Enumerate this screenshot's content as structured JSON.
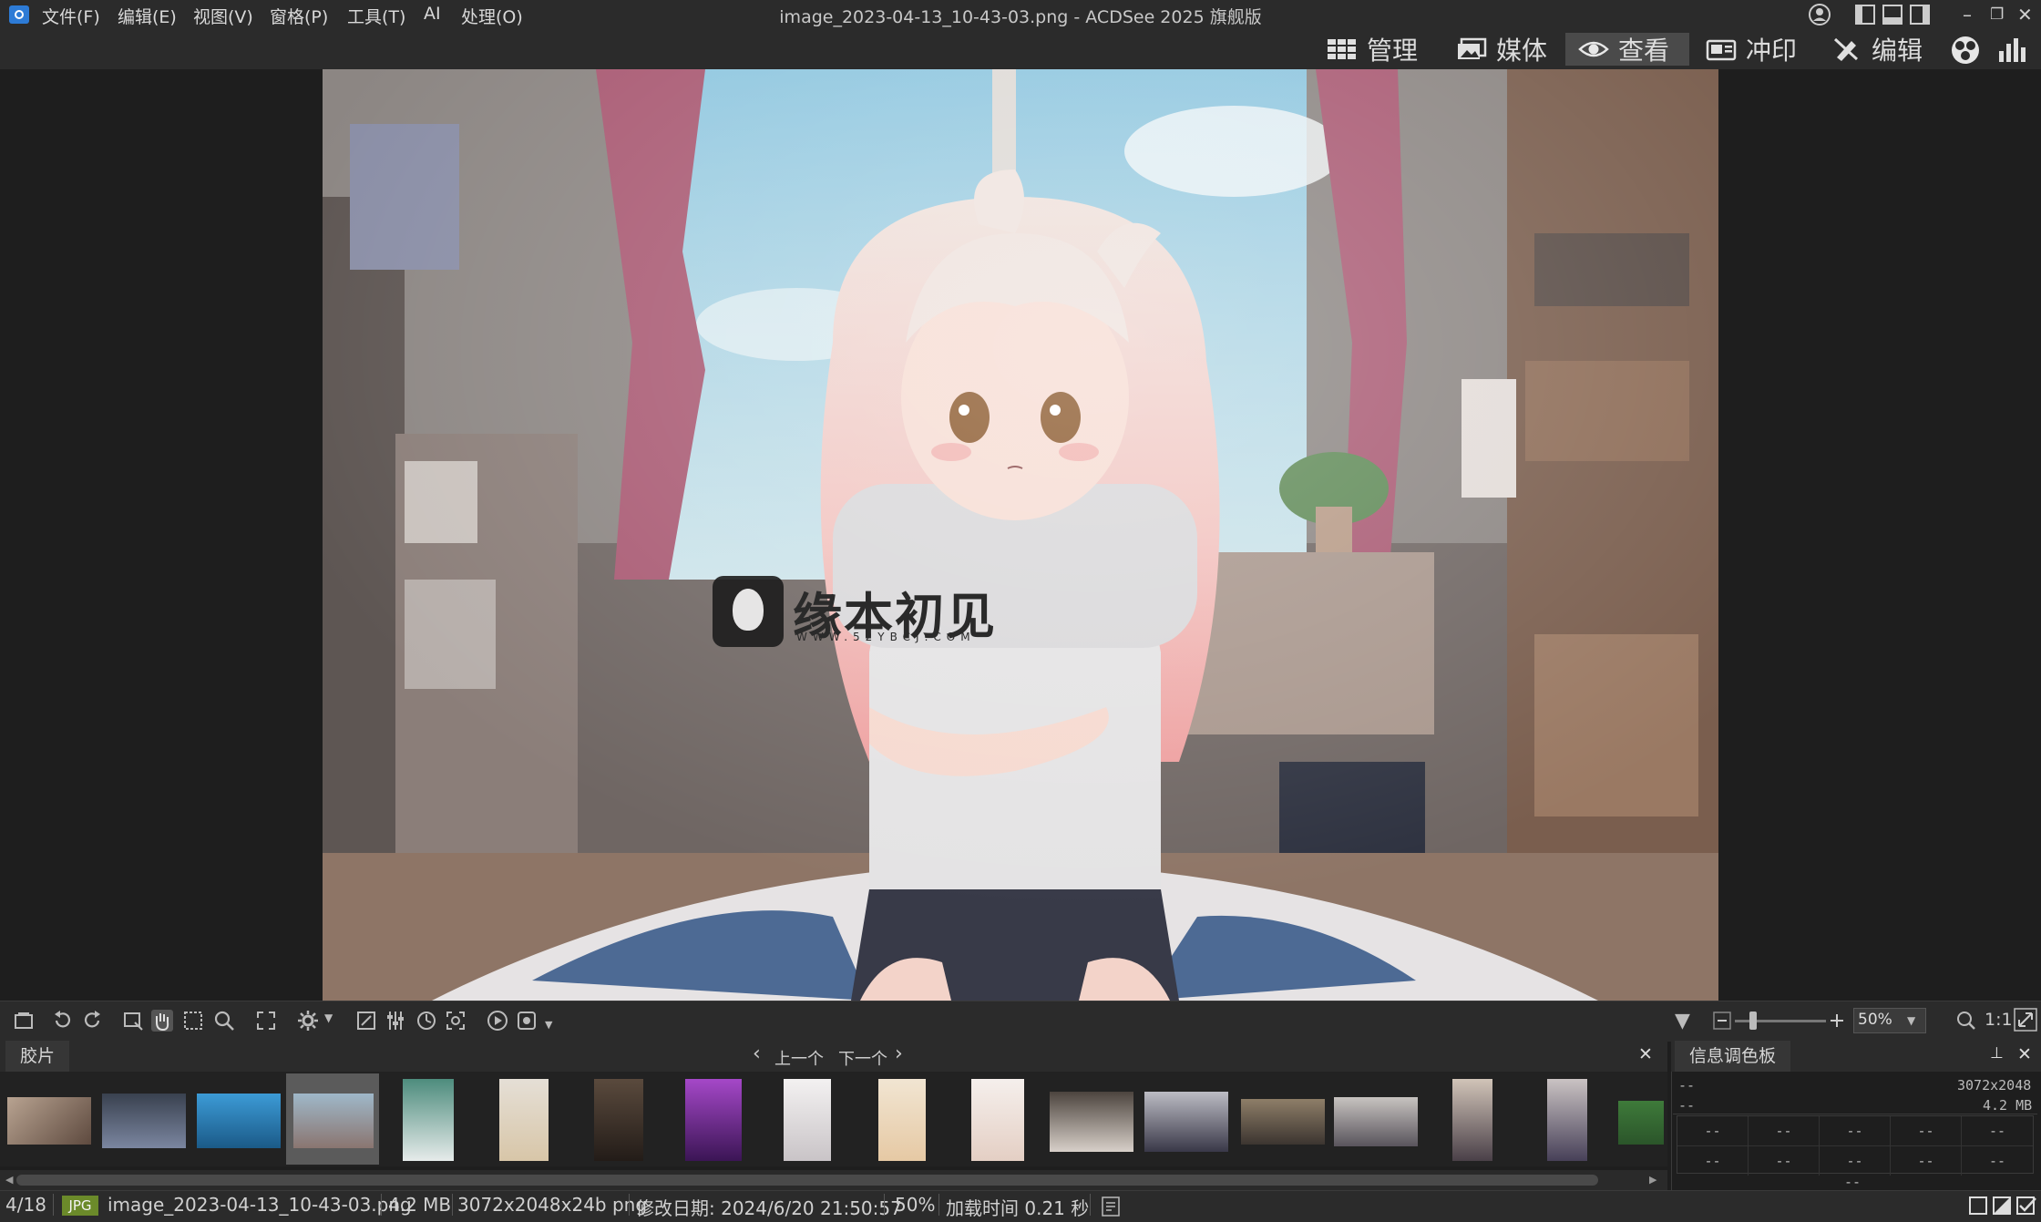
{
  "window": {
    "title": "image_2023-04-13_10-43-03.png - ACDSee 2025 旗舰版"
  },
  "menu": [
    "文件(F)",
    "编辑(E)",
    "视图(V)",
    "窗格(P)",
    "工具(T)",
    "AI",
    "处理(O)"
  ],
  "modes": [
    {
      "label": "管理",
      "icon": "grid-icon"
    },
    {
      "label": "媒体",
      "icon": "media-icon"
    },
    {
      "label": "查看",
      "icon": "eye-icon",
      "active": true
    },
    {
      "label": "冲印",
      "icon": "develop-icon"
    },
    {
      "label": "编辑",
      "icon": "edit-icon"
    }
  ],
  "watermark": {
    "text": "缘本初见",
    "url": "WWW.52YBCJ.COM"
  },
  "toolbar": {
    "zoom_value": "50%",
    "one_to_one": "1:1"
  },
  "filmstrip": {
    "tab_label": "胶片",
    "prev_label": "上一个",
    "next_label": "下一个",
    "selected_index": 3,
    "thumb_count": 18
  },
  "info_panel": {
    "tab_label": "信息调色板",
    "row1_left": "--",
    "row1_right": "3072x2048",
    "row2_left": "--",
    "row2_right": "4.2 MB",
    "grid_cell": "--",
    "footer": "--"
  },
  "status": {
    "position": "4/18",
    "format": "JPG",
    "filename": "image_2023-04-13_10-43-03.png",
    "size": "4.2 MB",
    "dimensions": "3072x2048x24b png",
    "modified": "修改日期: 2024/6/20 21:50:57",
    "zoom": "50%",
    "load_time": "加载时间 0.21 秒"
  },
  "colors": {
    "accent": "#2d7bd6",
    "active_mode_bg": "#4a4a4a",
    "format_badge": "#6b8a2a"
  }
}
